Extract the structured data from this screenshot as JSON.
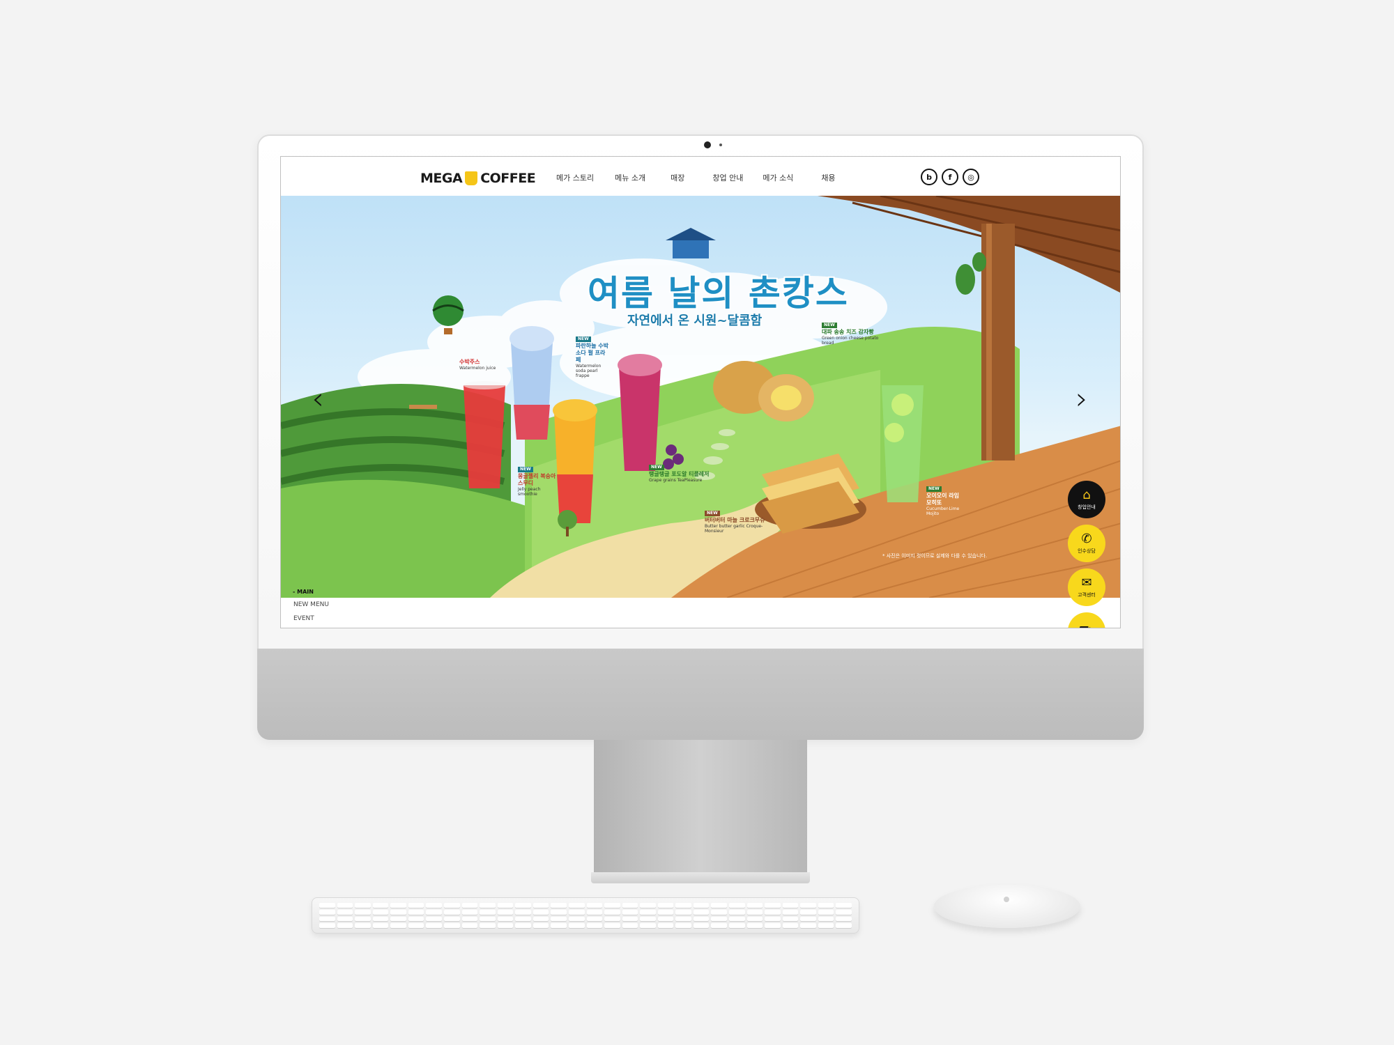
{
  "header": {
    "logo_left": "MEGA",
    "logo_right": "COFFEE",
    "nav": [
      "메가 스토리",
      "메뉴 소개",
      "매장",
      "창업 안내",
      "메가 소식",
      "채용"
    ],
    "social": [
      {
        "icon": "blog-icon",
        "glyph": "b"
      },
      {
        "icon": "facebook-icon",
        "glyph": "f"
      },
      {
        "icon": "instagram-icon",
        "glyph": "◎"
      }
    ]
  },
  "hero": {
    "title": "여름 날의 촌캉스",
    "subtitle": "자연에서 온 시원~달콤함",
    "prev_glyph": "‹",
    "next_glyph": "›",
    "notice": "* 사진은 이미지 컷이므로 실제와 다를 수 있습니다.",
    "products": [
      {
        "new": "",
        "ko": "수박주스",
        "en": "Watermelon juice"
      },
      {
        "new": "NEW",
        "ko": "파란하늘 수박소다 펄 프라페",
        "en": "Watermelon soda pearl frappe"
      },
      {
        "new": "NEW",
        "ko": "몽글젤리 복숭아 스무디",
        "en": "Jelly peach smoothie"
      },
      {
        "new": "NEW",
        "ko": "탱글탱글 포도알 티플레저",
        "en": "Grape grains TeaPleasure"
      },
      {
        "new": "NEW",
        "ko": "대파 송송 치즈 감자빵",
        "en": "Green onion cheese potato bread"
      },
      {
        "new": "NEW",
        "ko": "버터버터 마늘 크로크무슈",
        "en": "Butter butter garlic Croque-Monsieur"
      },
      {
        "new": "NEW",
        "ko": "오이오이 라임 모히또",
        "en": "Cucumber-Lime Mojito"
      }
    ]
  },
  "subnav": {
    "main": "- MAIN",
    "items": [
      "NEW MENU",
      "EVENT"
    ]
  },
  "quick_menu": [
    {
      "icon": "store-icon",
      "glyph": "⌂",
      "label": "창업안내"
    },
    {
      "icon": "phone-icon",
      "glyph": "✆",
      "label": "인수상담"
    },
    {
      "icon": "chat-icon",
      "glyph": "✉",
      "label": "고객센터"
    },
    {
      "icon": "cart-icon",
      "glyph": "⛟",
      "label": ""
    }
  ],
  "colors": {
    "brand_yellow": "#f8d81c",
    "title_blue": "#1f8fc4",
    "sky": "#bfe1f7"
  }
}
